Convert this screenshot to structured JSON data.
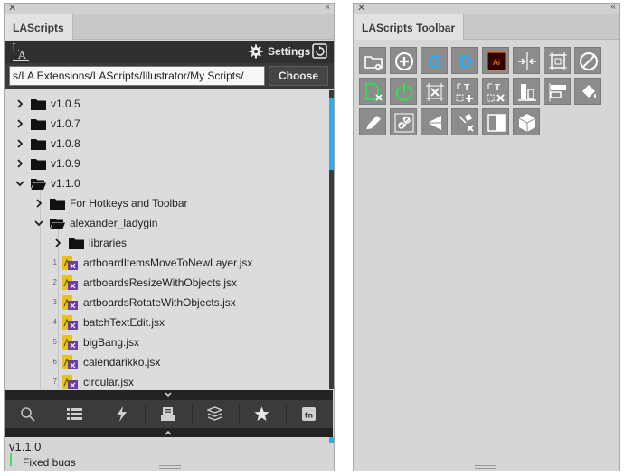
{
  "left_panel": {
    "tab_label": "LAScripts",
    "header": {
      "settings_label": "Settings"
    },
    "path": {
      "value": "s/LA Extensions/LAScripts/Illustrator/My Scripts/",
      "choose_label": "Choose"
    },
    "tree": [
      {
        "type": "folder",
        "name": "v1.0.5",
        "expanded": false
      },
      {
        "type": "folder",
        "name": "v1.0.7",
        "expanded": false
      },
      {
        "type": "folder",
        "name": "v1.0.8",
        "expanded": false
      },
      {
        "type": "folder",
        "name": "v1.0.9",
        "expanded": false
      },
      {
        "type": "folder",
        "name": "v1.1.0",
        "expanded": true
      },
      {
        "type": "folder",
        "name": "For Hotkeys and Toolbar",
        "expanded": false
      },
      {
        "type": "folder",
        "name": "alexander_ladygin",
        "expanded": true
      },
      {
        "type": "folder",
        "name": "libraries",
        "expanded": false
      },
      {
        "type": "file",
        "num": "1",
        "name": "artboardItemsMoveToNewLayer.jsx"
      },
      {
        "type": "file",
        "num": "2",
        "name": "artboardsResizeWithObjects.jsx"
      },
      {
        "type": "file",
        "num": "3",
        "name": "artboardsRotateWithObjects.jsx"
      },
      {
        "type": "file",
        "num": "4",
        "name": "batchTextEdit.jsx"
      },
      {
        "type": "file",
        "num": "5",
        "name": "bigBang.jsx"
      },
      {
        "type": "file",
        "num": "6",
        "name": "calendarikko.jsx"
      },
      {
        "type": "file",
        "num": "7",
        "name": "circular.jsx"
      }
    ],
    "bottom_toolbar_icons": [
      "search-icon",
      "list-icon",
      "lightning-icon",
      "printer-icon",
      "layers-icon",
      "star-icon",
      "function-icon"
    ],
    "info": {
      "version": "v1.1.0",
      "note": "Fixed bugs"
    },
    "colors": {
      "accent": "#29aef0",
      "dark": "#2f2f2f"
    }
  },
  "right_panel": {
    "tab_label": "LAScripts Toolbar",
    "tools": [
      {
        "icon": "folder-open-icon"
      },
      {
        "icon": "add-circle-icon"
      },
      {
        "icon": "letter-g-icon",
        "letter": "G"
      },
      {
        "icon": "letter-d-icon",
        "letter": "D"
      },
      {
        "icon": "illustrator-icon",
        "letter": "Ai"
      },
      {
        "icon": "distribute-horizontal-icon"
      },
      {
        "icon": "artboard-fit-icon"
      },
      {
        "icon": "prohibited-icon"
      },
      {
        "icon": "file-remove-icon"
      },
      {
        "icon": "power-icon"
      },
      {
        "icon": "frame-remove-icon"
      },
      {
        "icon": "text-add-icon",
        "letter": "T"
      },
      {
        "icon": "text-remove-icon",
        "letter": "T"
      },
      {
        "icon": "align-bottom-icon"
      },
      {
        "icon": "align-top-icon"
      },
      {
        "icon": "fill-bucket-icon"
      },
      {
        "icon": "pen-edit-icon"
      },
      {
        "icon": "link-edit-icon"
      },
      {
        "icon": "perspective-icon"
      },
      {
        "icon": "tools-remove-icon"
      },
      {
        "icon": "split-columns-icon"
      },
      {
        "icon": "cube-icon"
      }
    ]
  }
}
